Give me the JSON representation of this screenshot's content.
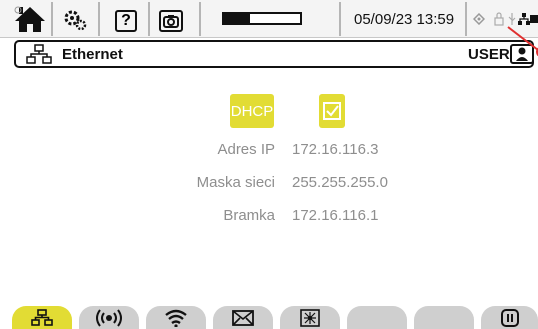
{
  "statusbar": {
    "datetime": "05/09/23 13:59",
    "progress_fraction": 0.34,
    "icons": [
      "home-icon",
      "settings-icon",
      "help-icon",
      "camera-icon",
      "diamond-icon",
      "lock-icon",
      "usb-icon",
      "ethernet-icon",
      "battery-icon"
    ]
  },
  "header": {
    "title": "Ethernet",
    "user": "USER1"
  },
  "form": {
    "dhcp_label": "DHCP",
    "dhcp_checked": true,
    "fields": [
      {
        "label": "Adres IP",
        "value": "172.16.116.3"
      },
      {
        "label": "Maska sieci",
        "value": "255.255.255.0"
      },
      {
        "label": "Bramka",
        "value": "172.16.116.1"
      }
    ]
  },
  "tabs": [
    {
      "name": "ethernet-tab",
      "icon": "ethernet-icon",
      "active": true
    },
    {
      "name": "radio-tab",
      "icon": "radio-icon",
      "active": false
    },
    {
      "name": "wifi-tab",
      "icon": "wifi-icon",
      "active": false
    },
    {
      "name": "email-tab",
      "icon": "envelope-icon",
      "active": false
    },
    {
      "name": "network-tab",
      "icon": "network-node-icon",
      "active": false
    },
    {
      "name": "empty-tab-1",
      "icon": "",
      "active": false
    },
    {
      "name": "empty-tab-2",
      "icon": "",
      "active": false
    },
    {
      "name": "pause-tab",
      "icon": "pause-icon",
      "active": false
    }
  ],
  "colors": {
    "accent": "#e2dc34",
    "tab_inactive": "#cfcfcf",
    "text_muted": "#8e8e8e",
    "callout": "#e03030"
  }
}
